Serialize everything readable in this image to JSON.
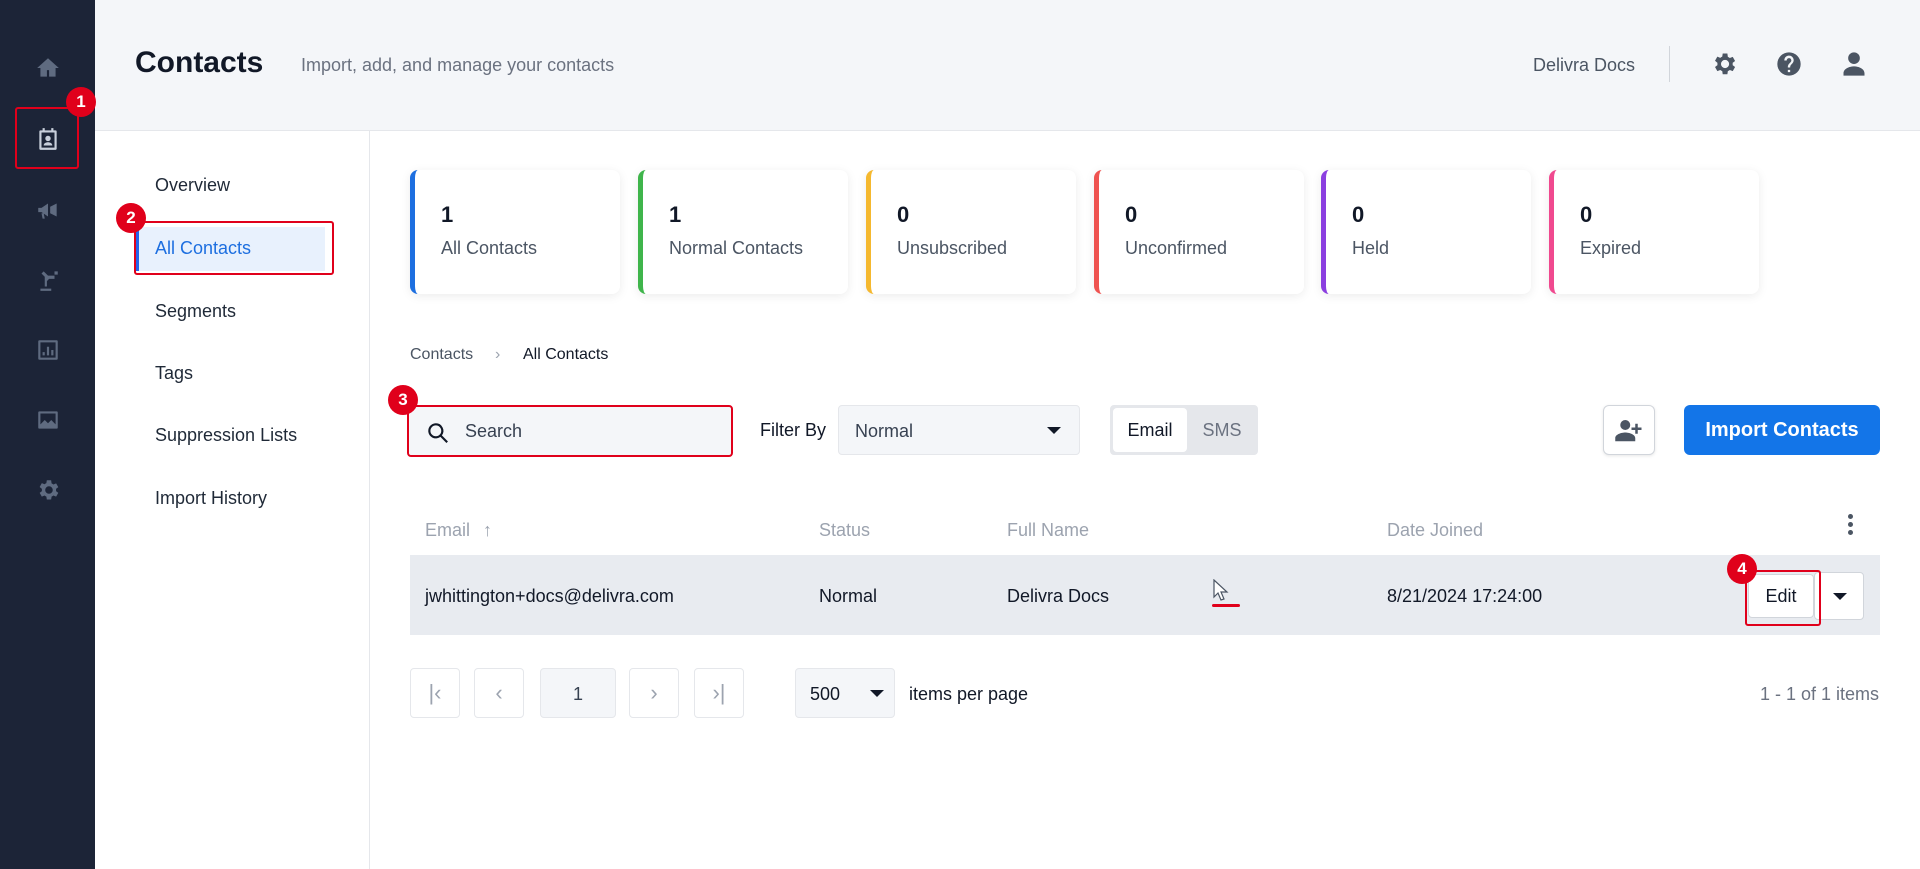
{
  "header": {
    "title": "Contacts",
    "subtitle": "Import, add, and manage your contacts",
    "account": "Delivra Docs"
  },
  "rail": {
    "items": [
      "home-icon",
      "contacts-icon",
      "megaphone-icon",
      "automation-icon",
      "reports-icon",
      "images-icon",
      "settings-icon"
    ],
    "active": "contacts-icon"
  },
  "subnav": {
    "items": [
      "Overview",
      "All Contacts",
      "Segments",
      "Tags",
      "Suppression Lists",
      "Import History"
    ],
    "active": "All Contacts"
  },
  "stats": [
    {
      "value": "1",
      "label": "All Contacts",
      "color": "#1d6fe0"
    },
    {
      "value": "1",
      "label": "Normal Contacts",
      "color": "#3fb54b"
    },
    {
      "value": "0",
      "label": "Unsubscribed",
      "color": "#f5b82e"
    },
    {
      "value": "0",
      "label": "Unconfirmed",
      "color": "#ef5350"
    },
    {
      "value": "0",
      "label": "Held",
      "color": "#8b3fe0"
    },
    {
      "value": "0",
      "label": "Expired",
      "color": "#f0498f"
    }
  ],
  "breadcrumb": {
    "parent": "Contacts",
    "separator": "›",
    "current": "All Contacts"
  },
  "toolbar": {
    "search_placeholder": "Search",
    "filter_label": "Filter By",
    "filter_value": "Normal",
    "toggle_on": "Email",
    "toggle_off": "SMS",
    "import_label": "Import Contacts"
  },
  "table": {
    "headers": [
      "Email",
      "Status",
      "Full Name",
      "Date Joined"
    ],
    "sort_indicator": "↑",
    "rows": [
      {
        "email": "jwhittington+docs@delivra.com",
        "status": "Normal",
        "full_name": "Delivra Docs",
        "date_joined": "8/21/2024 17:24:00",
        "action": "Edit"
      }
    ]
  },
  "pager": {
    "current_page": "1",
    "per_page": "500",
    "per_page_label": "items per page",
    "count": "1 - 1 of 1 items"
  },
  "annotations": [
    "1",
    "2",
    "3",
    "4"
  ]
}
